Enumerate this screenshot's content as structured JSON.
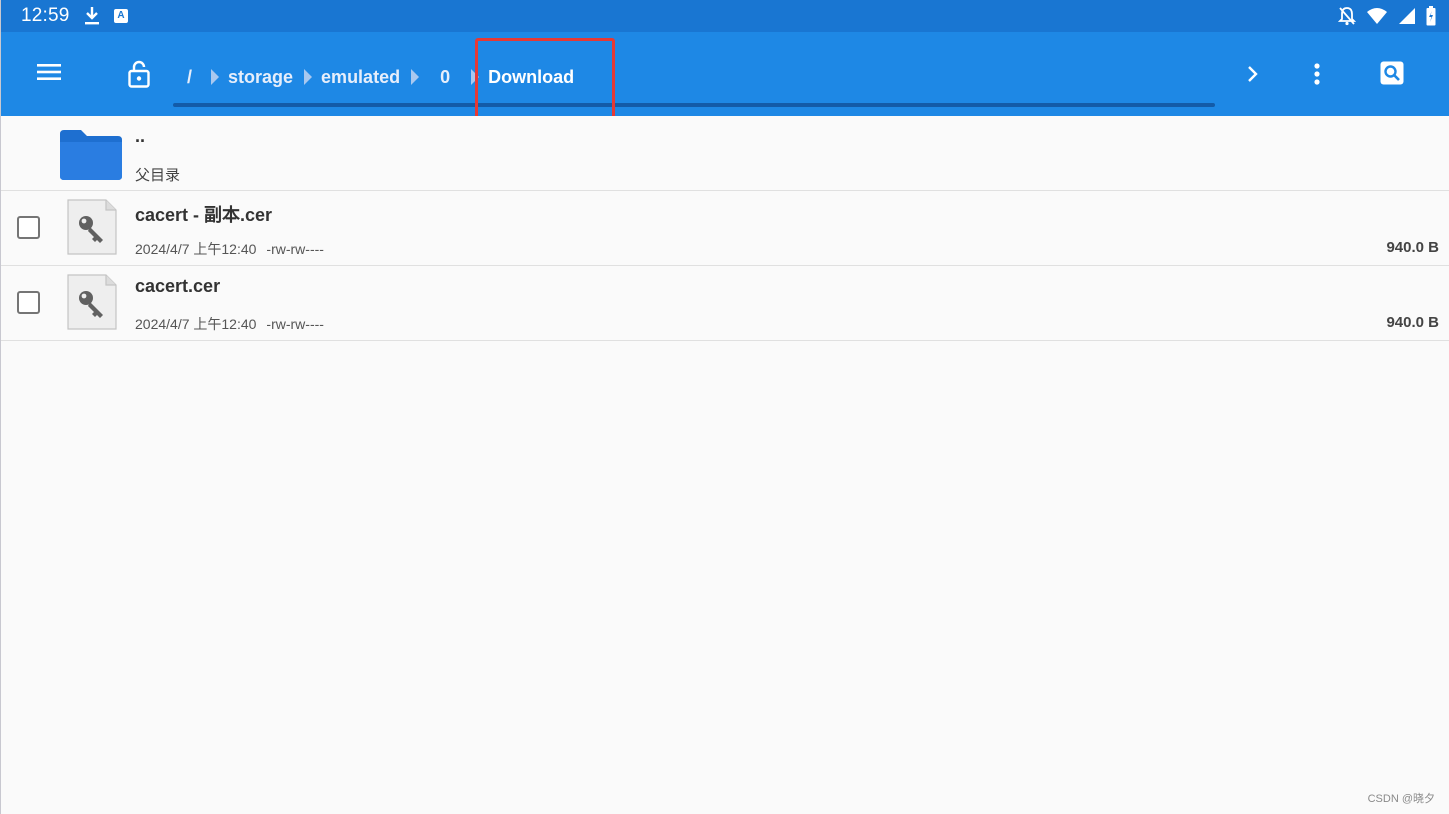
{
  "status_bar": {
    "time": "12:59",
    "icons": [
      "download-icon",
      "a-badge-icon",
      "notifications-off-icon",
      "wifi-icon",
      "signal-icon",
      "battery-icon"
    ],
    "badge_letter": "A"
  },
  "toolbar": {
    "menu_icon": "hamburger-menu-icon",
    "lock_icon": "unlock-icon",
    "breadcrumbs": [
      "/",
      "storage",
      "emulated",
      "0",
      "Download"
    ],
    "forward_icon": "chevron-right-icon",
    "more_icon": "more-vert-icon",
    "search_icon": "search-icon",
    "highlight_color": "#e53935"
  },
  "file_list": {
    "parent": {
      "name": "..",
      "label": "父目录"
    },
    "items": [
      {
        "name": "cacert - 副本.cer",
        "date": "2024/4/7 上午12:40",
        "permissions": "-rw-rw----",
        "size": "940.0 B",
        "checked": false,
        "icon": "key-file-icon"
      },
      {
        "name": "cacert.cer",
        "date": "2024/4/7 上午12:40",
        "permissions": "-rw-rw----",
        "size": "940.0 B",
        "checked": false,
        "icon": "key-file-icon"
      }
    ]
  },
  "watermark": "CSDN @晓夕",
  "colors": {
    "status_bar": "#1976d2",
    "toolbar": "#1e88e5",
    "folder": "#1e6fd0"
  }
}
